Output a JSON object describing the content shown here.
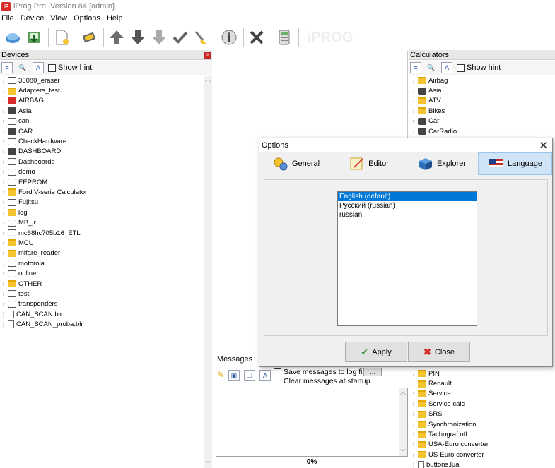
{
  "window": {
    "title": "iProg Pro. Version 84 [admin]",
    "app_icon_text": "iP"
  },
  "menu": [
    "File",
    "Device",
    "View",
    "Options",
    "Help"
  ],
  "toolbar": {
    "buttons": [
      "connect-icon",
      "download-icon",
      "new-file-icon",
      "chip-icon",
      "arrow-up-icon",
      "arrow-down-icon",
      "arrow-down-gray-icon",
      "checkmark-icon",
      "eraser-icon",
      "info-icon",
      "cross-icon",
      "calculator-icon"
    ],
    "ghost_text": "iPROG"
  },
  "devices": {
    "title": "Devices",
    "show_hint": "Show hint",
    "items": [
      {
        "label": "35080_eraser",
        "icon": "gen",
        "exp": "›"
      },
      {
        "label": "Adapters_test",
        "icon": "folder",
        "exp": "›"
      },
      {
        "label": "AIRBAG",
        "icon": "red",
        "exp": "›"
      },
      {
        "label": "Asia",
        "icon": "dark",
        "exp": "›"
      },
      {
        "label": "can",
        "icon": "gen",
        "exp": "›"
      },
      {
        "label": "CAR",
        "icon": "dark",
        "exp": "›"
      },
      {
        "label": "CheckHardware",
        "icon": "gen",
        "exp": "›"
      },
      {
        "label": "DASHBOARD",
        "icon": "dark",
        "exp": "›"
      },
      {
        "label": "Dashboards",
        "icon": "gen",
        "exp": "›"
      },
      {
        "label": "demo",
        "icon": "gen",
        "exp": "›"
      },
      {
        "label": "EEPROM",
        "icon": "gen",
        "exp": "›"
      },
      {
        "label": "Ford V-serie Calculator",
        "icon": "folder",
        "exp": "›"
      },
      {
        "label": "Fujitsu",
        "icon": "gen",
        "exp": "›"
      },
      {
        "label": "log",
        "icon": "folder",
        "exp": "›"
      },
      {
        "label": "MB_ir",
        "icon": "gen",
        "exp": "›"
      },
      {
        "label": "mc68hc705b16_ETL",
        "icon": "gen",
        "exp": "›"
      },
      {
        "label": "MCU",
        "icon": "folder",
        "exp": "›"
      },
      {
        "label": "mifare_reader",
        "icon": "folder",
        "exp": "›"
      },
      {
        "label": "motorola",
        "icon": "gen",
        "exp": "›"
      },
      {
        "label": "online",
        "icon": "gen",
        "exp": "›"
      },
      {
        "label": "OTHER",
        "icon": "folder",
        "exp": "›"
      },
      {
        "label": "test",
        "icon": "gen",
        "exp": "›"
      },
      {
        "label": "transponders",
        "icon": "gen",
        "exp": "›"
      },
      {
        "label": "CAN_SCAN.blr",
        "icon": "file",
        "exp": ""
      },
      {
        "label": "CAN_SCAN_proba.blr",
        "icon": "file",
        "exp": ""
      }
    ]
  },
  "calculators": {
    "title": "Calculators",
    "show_hint": "Show hint",
    "items_top": [
      {
        "label": "Airbag",
        "icon": "folder"
      },
      {
        "label": "Asia",
        "icon": "dark"
      },
      {
        "label": "ATV",
        "icon": "folder"
      },
      {
        "label": "Bikes",
        "icon": "folder"
      },
      {
        "label": "Car",
        "icon": "dark"
      },
      {
        "label": "CarRadio",
        "icon": "dark"
      }
    ],
    "items_bottom": [
      {
        "label": "PIN",
        "icon": "folder"
      },
      {
        "label": "Renault",
        "icon": "folder"
      },
      {
        "label": "Service",
        "icon": "folder"
      },
      {
        "label": "Service calc",
        "icon": "folder"
      },
      {
        "label": "SRS",
        "icon": "folder"
      },
      {
        "label": "Synchronization",
        "icon": "folder"
      },
      {
        "label": "Tachograf off",
        "icon": "folder"
      },
      {
        "label": "USA-Euro converter",
        "icon": "folder"
      },
      {
        "label": "US-Euro converter",
        "icon": "folder"
      },
      {
        "label": "buttons.lua",
        "icon": "file"
      }
    ]
  },
  "messages": {
    "title": "Messages",
    "save_label": "Save messages to log fi",
    "browse_label": "...",
    "clear_label": "Clear messages at startup",
    "progress": "0%"
  },
  "dialog": {
    "title": "Options",
    "close": "✕",
    "tabs": [
      {
        "label": "General",
        "active": false
      },
      {
        "label": "Editor",
        "active": false
      },
      {
        "label": "Explorer",
        "active": false
      },
      {
        "label": "Language",
        "active": true
      }
    ],
    "languages": [
      {
        "label": "English (default)",
        "selected": true
      },
      {
        "label": "Русский (russian)",
        "selected": false
      },
      {
        "label": "russian",
        "selected": false
      }
    ],
    "apply_label": "Apply",
    "close_label": "Close"
  }
}
